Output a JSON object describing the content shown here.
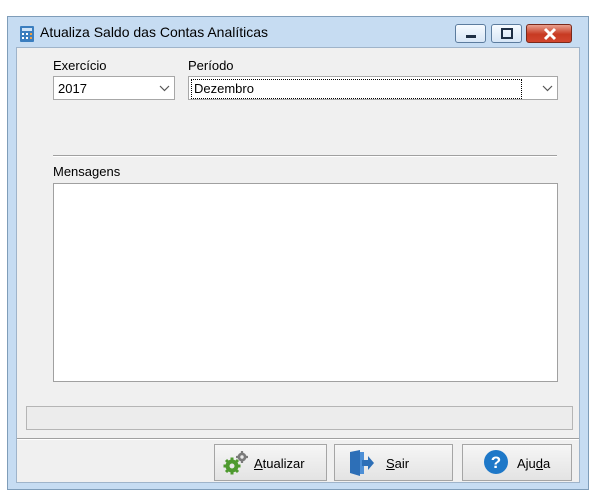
{
  "window": {
    "title": "Atualiza Saldo das Contas Analíticas"
  },
  "form": {
    "exercicio_label": "Exercício",
    "exercicio_value": "2017",
    "periodo_label": "Período",
    "periodo_value": "Dezembro",
    "mensagens_label": "Mensagens"
  },
  "buttons": {
    "atualizar": {
      "accel": "A",
      "rest": "tualizar",
      "icon": "gears-icon"
    },
    "sair": {
      "accel": "S",
      "rest": "air",
      "icon": "exit-door-icon"
    },
    "ajuda": {
      "prefix": "Aju",
      "accel": "d",
      "rest": "a",
      "icon": "help-icon"
    }
  },
  "colors": {
    "frame": "#c6dcf2",
    "client": "#f0f0f0",
    "close": "#c73a22",
    "help": "#1e78c8"
  }
}
